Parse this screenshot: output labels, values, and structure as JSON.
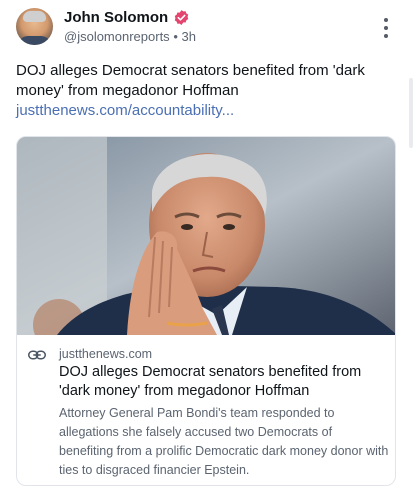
{
  "author": {
    "display_name": "John Solomon",
    "handle": "@jsolomonreports",
    "separator": "•",
    "timestamp": "3h",
    "avatar_icon": "user-avatar",
    "verified_icon": "verified-badge-icon",
    "verified_color": "#e4456f"
  },
  "post": {
    "text": "DOJ alleges Democrat senators benefited from 'dark money' from megadonor Hoffman ",
    "link_text": "justthenews.com/accountability...",
    "link_color": "#4a6fb3"
  },
  "link_card": {
    "image_icon": "senator-photo",
    "link_icon": "link-chain-icon",
    "domain": "justthenews.com",
    "title": "DOJ alleges Democrat senators benefited from 'dark money' from megadonor Hoffman",
    "description": "Attorney General Pam Bondi's team responded to allegations she falsely accused two Democrats of benefiting from a prolific Democratic dark money donor with ties to disgraced financier Epstein."
  },
  "menu": {
    "icon": "more-vertical-icon"
  }
}
